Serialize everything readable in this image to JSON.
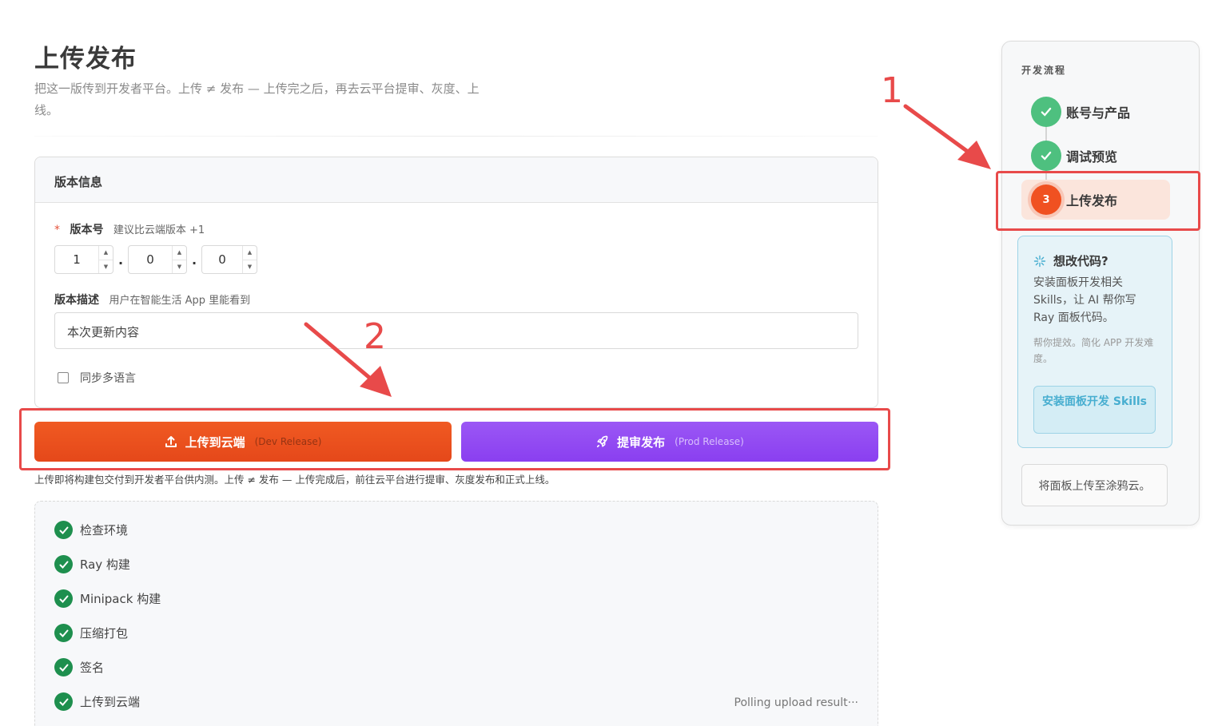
{
  "page": {
    "title": "上传发布",
    "description": "把这一版传到开发者平台。上传 ≠ 发布 — 上传完之后，再去云平台提审、灰度、上线。"
  },
  "version_card": {
    "header": "版本信息",
    "version_label": "版本号",
    "version_hint": "建议比云端版本 +1",
    "version_parts": [
      "1",
      "0",
      "0"
    ],
    "desc_label": "版本描述",
    "desc_hint": "用户在智能生活 App 里能看到",
    "desc_value": "本次更新内容",
    "sync_label": "同步多语言",
    "sync_checked": false
  },
  "actions": {
    "dev_label": "上传到云端",
    "dev_sub": "(Dev Release)",
    "prod_label": "提审发布",
    "prod_sub": "(Prod Release)",
    "hint": "上传即将构建包交付到开发者平台供内测。上传 ≠ 发布 — 上传完成后，前往云平台进行提审、灰度发布和正式上线。"
  },
  "steps": {
    "items": [
      {
        "label": "检查环境",
        "status": "done"
      },
      {
        "label": "Ray 构建",
        "status": "done"
      },
      {
        "label": "Minipack 构建",
        "status": "done"
      },
      {
        "label": "压缩打包",
        "status": "done"
      },
      {
        "label": "签名",
        "status": "done"
      },
      {
        "label": "上传到云端",
        "status": "done"
      }
    ],
    "polling_text": "Polling upload result···"
  },
  "sidebar": {
    "title": "开发流程",
    "flow": [
      {
        "label": "账号与产品",
        "status": "done"
      },
      {
        "label": "调试预览",
        "status": "done"
      },
      {
        "label": "上传发布",
        "status": "active",
        "number": "3"
      }
    ],
    "tip": {
      "title": "想改代码?",
      "body": "安装面板开发相关 Skills，让 AI 帮你写 Ray 面板代码。",
      "small": "帮你提效。简化 APP 开发难度。",
      "button": "安装面板开发 Skills"
    },
    "upload_tuya": "将面板上传至涂鸦云。"
  },
  "annotations": {
    "label_1": "1",
    "label_2": "2"
  },
  "colors": {
    "dev_button": "#ee5320",
    "prod_button": "#9350f3",
    "success": "#1e8f4e",
    "annotation": "#e84a4a"
  }
}
